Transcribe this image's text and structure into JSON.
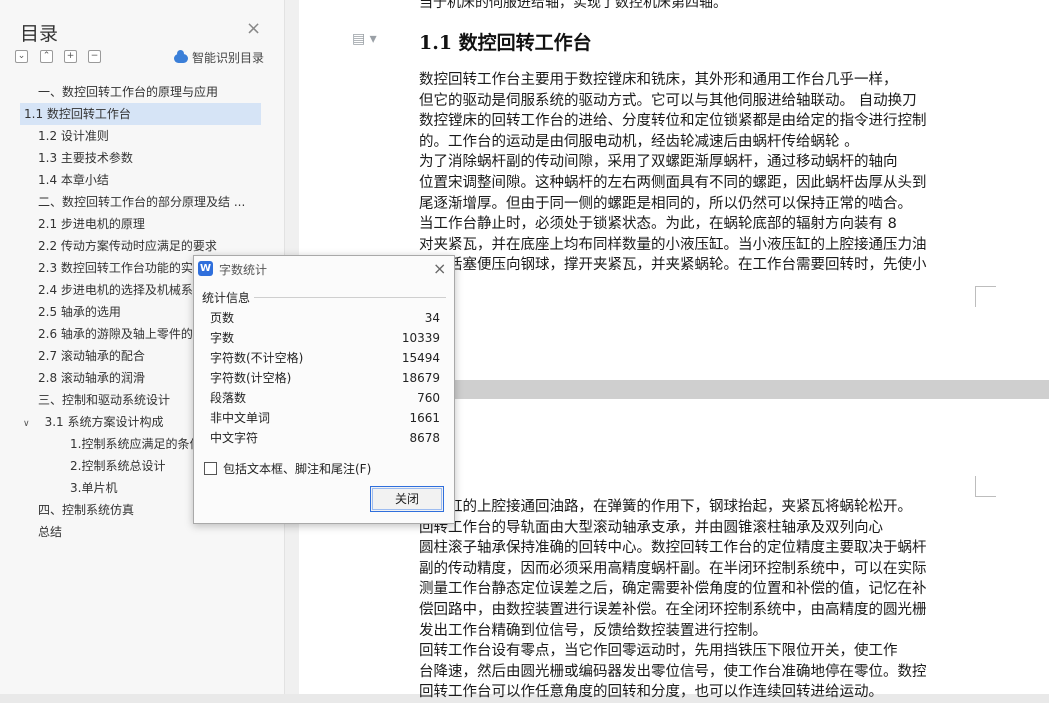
{
  "toc": {
    "title": "目录",
    "smart_label": "智能识别目录",
    "items": [
      {
        "label": "一、数控回转工作台的原理与应用",
        "indent": 38
      },
      {
        "label": "1.1 数控回转工作台",
        "indent": 24,
        "selected": true
      },
      {
        "label": "1.2   设计准则",
        "indent": 38
      },
      {
        "label": "1.3   主要技术参数",
        "indent": 38
      },
      {
        "label": "1.4 本章小结",
        "indent": 38
      },
      {
        "label": "二、数控回转工作台的部分原理及结 ...",
        "indent": 38
      },
      {
        "label": "2.1 步进电机的原理",
        "indent": 38
      },
      {
        "label": "2.2 传动方案传动时应满足的要求",
        "indent": 38
      },
      {
        "label": "2.3 数控回转工作台功能的实现",
        "indent": 38
      },
      {
        "label": "2.4 步进电机的选择及机械系统",
        "indent": 38
      },
      {
        "label": "2.5 轴承的选用",
        "indent": 38
      },
      {
        "label": "2.6 轴承的游隙及轴上零件的",
        "indent": 38
      },
      {
        "label": "2.7 滚动轴承的配合",
        "indent": 38
      },
      {
        "label": "2.8 滚动轴承的润滑",
        "indent": 38
      },
      {
        "label": "三、控制和驱动系统设计",
        "indent": 38
      },
      {
        "label": "3.1 系统方案设计构成",
        "indent": 38,
        "expanded": true
      },
      {
        "label": "1.控制系统应满足的条件",
        "indent": 70
      },
      {
        "label": "2.控制系统总设计",
        "indent": 70
      },
      {
        "label": "3.单片机",
        "indent": 70
      },
      {
        "label": "四、控制系统仿真",
        "indent": 38
      },
      {
        "label": "总结",
        "indent": 38
      }
    ]
  },
  "document": {
    "top_cut_line": "当于机床的伺服进给轴，实现了数控机床第四轴。",
    "heading": "1.1 数控回转工作台",
    "page1_lines": [
      "        数控回转工作台主要用于数控镗床和铣床，其外形和通用工作台几乎一样，",
      "但它的驱动是伺服系统的驱动方式。它可以与其他伺服进给轴联动。 自动换刀",
      "数控镗床的回转工作台的进给、分度转位和定位锁紧都是由给定的指令进行控制",
      "的。工作台的运动是由伺服电动机，经齿轮减速后由蜗杆传给蜗轮 。",
      "    为了消除蜗杆副的传动间隙，采用了双螺距渐厚蜗杆，通过移动蜗杆的轴向",
      "位置宋调整间隙。这种蜗杆的左右两侧面具有不同的螺距，因此蜗杆齿厚从头到",
      "尾逐渐增厚。但由于同一侧的螺距是相同的，所以仍然可以保持正常的啮合。",
      "    当工作台静止时，必须处于锁紧状态。为此，在蜗轮底部的辐射方向装有 8",
      "对夹紧瓦，并在底座上均布同样数量的小液压缸。当小液压缸的上腔接通压力油",
      "时，活塞便压向钢球，撑开夹紧瓦，并夹紧蜗轮。在工作台需要回转时，先使小"
    ],
    "page2_lines": [
      "液压缸的上腔接通回油路，在弹簧的作用下，钢球抬起，夹紧瓦将蜗轮松开。",
      "    回转工作台的导轨面由大型滚动轴承支承，并由圆锥滚柱轴承及双列向心",
      "圆柱滚子轴承保持准确的回转中心。数控回转工作台的定位精度主要取决于蜗杆",
      "副的传动精度，因而必须采用高精度蜗杆副。在半闭环控制系统中，可以在实际",
      "测量工作台静态定位误差之后，确定需要补偿角度的位置和补偿的值，记忆在补",
      "偿回路中，由数控装置进行误差补偿。在全闭环控制系统中，由高精度的圆光栅",
      "发出工作台精确到位信号，反馈给数控装置进行控制。",
      "    回转工作台设有零点，当它作回零运动时，先用挡铁压下限位开关，使工作",
      "台降速，然后由圆光栅或编码器发出零位信号，使工作台准确地停在零位。数控",
      "回转工作台可以作任意角度的回转和分度，也可以作连续回转进给运动。"
    ]
  },
  "dialog": {
    "title": "字数统计",
    "logo": "W",
    "group_label": "统计信息",
    "stats": [
      {
        "label": "页数",
        "value": "34"
      },
      {
        "label": "字数",
        "value": "10339"
      },
      {
        "label": "字符数(不计空格)",
        "value": "15494"
      },
      {
        "label": "字符数(计空格)",
        "value": "18679"
      },
      {
        "label": "段落数",
        "value": "760"
      },
      {
        "label": "非中文单词",
        "value": "1661"
      },
      {
        "label": "中文字符",
        "value": "8678"
      }
    ],
    "include_label": "包括文本框、脚注和尾注(F)",
    "close_button": "关闭"
  }
}
